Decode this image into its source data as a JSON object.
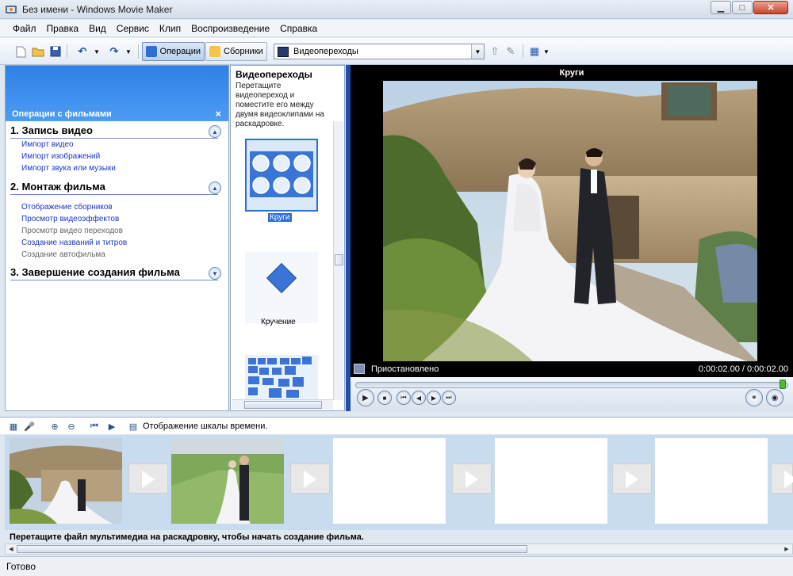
{
  "window": {
    "title": "Без имени - Windows Movie Maker"
  },
  "menu": [
    "Файл",
    "Правка",
    "Вид",
    "Сервис",
    "Клип",
    "Воспроизведение",
    "Справка"
  ],
  "toolbar": {
    "operations_label": "Операции",
    "collections_label": "Сборники",
    "collection_select": "Видеопереходы"
  },
  "task_pane": {
    "title": "Операции с фильмами",
    "sections": [
      {
        "heading": "1. Запись видео",
        "links": [
          "Импорт видео",
          "Импорт изображений",
          "Импорт звука или музыки"
        ]
      },
      {
        "heading": "2. Монтаж фильма",
        "links": [
          "Отображение сборников",
          "Просмотр видеоэффектов",
          "Просмотр видео переходов",
          "Создание названий и титров",
          "Создание автофильма"
        ]
      },
      {
        "heading": "3. Завершение создания фильма",
        "links": []
      }
    ]
  },
  "transitions": {
    "title": "Видеопереходы",
    "description": "Перетащите видеопереход и поместите его между двумя видеоклипами на раскадровке.",
    "items": [
      {
        "label": "Круги",
        "selected": true
      },
      {
        "label": "Кручение",
        "selected": false
      }
    ]
  },
  "monitor": {
    "clip_title": "Круги",
    "state": "Приостановлено",
    "time": "0:00:02.00 / 0:00:02.00",
    "progress": 1.0
  },
  "storyboard": {
    "view_label": "Отображение шкалы времени.",
    "hint": "Перетащите файл мультимедиа на раскадровку, чтобы начать создание фильма."
  },
  "status": "Готово",
  "colors": {
    "accent_blue": "#2f80e6",
    "link": "#1a36c8",
    "storyboard_bg": "#c9dbef"
  }
}
